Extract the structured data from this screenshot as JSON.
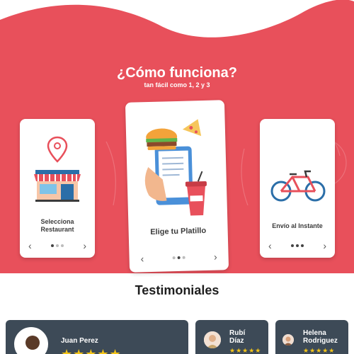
{
  "hero": {
    "title": "¿Cómo funciona?",
    "subtitle": "tan fácil como 1, 2 y 3",
    "bg_color": "#e8505b"
  },
  "steps": [
    {
      "label": "Selecciona Restaurant",
      "label_line1": "Selecciona",
      "label_line2": "Restaurant",
      "illustration": "restaurant-storefront-with-location-pin"
    },
    {
      "label": "Elige tu Platillo",
      "illustration": "burger-pizza-and-menu-in-hand"
    },
    {
      "label": "Envío al Instante",
      "illustration": "red-and-blue-bicycle"
    }
  ],
  "nav": {
    "prev_icon": "chevron-left-icon",
    "next_icon": "chevron-right-icon"
  },
  "testimonials": {
    "title": "Testimoniales",
    "items": [
      {
        "name": "Juan Perez",
        "stars": "★★★★★"
      },
      {
        "name_line1": "Rubí",
        "name_line2": "Díaz",
        "stars": "★★★★★"
      },
      {
        "name_line1": "Helena",
        "name_line2": "Rodriguez",
        "stars": "★★★★★"
      }
    ]
  },
  "colors": {
    "accent": "#e8505b",
    "card_dark": "#3d4a57",
    "star": "#f5c518"
  }
}
